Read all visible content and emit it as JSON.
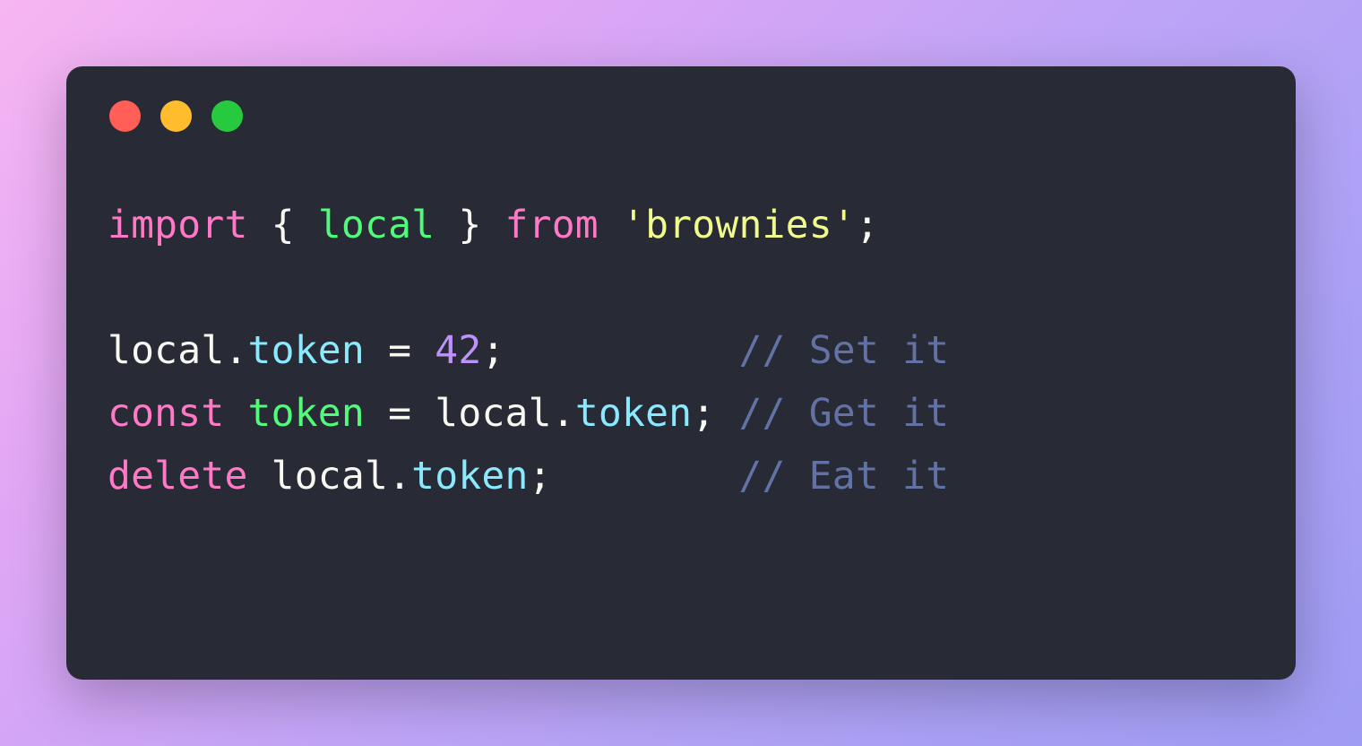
{
  "colors": {
    "window_bg": "#282a36",
    "traffic_red": "#ff5f56",
    "traffic_yellow": "#ffbd2e",
    "traffic_green": "#27c93f",
    "keyword": "#ff79c6",
    "identifier": "#50fa7b",
    "property": "#8be9fd",
    "string": "#f1fa8c",
    "number": "#bd93f9",
    "comment": "#6272a4",
    "plain": "#f8f8f2"
  },
  "code": {
    "lines": [
      [
        {
          "cls": "tok-keyword",
          "text": "import"
        },
        {
          "cls": "tok-plain",
          "text": " "
        },
        {
          "cls": "tok-punct",
          "text": "{"
        },
        {
          "cls": "tok-plain",
          "text": " "
        },
        {
          "cls": "tok-ident",
          "text": "local"
        },
        {
          "cls": "tok-plain",
          "text": " "
        },
        {
          "cls": "tok-punct",
          "text": "}"
        },
        {
          "cls": "tok-plain",
          "text": " "
        },
        {
          "cls": "tok-keyword",
          "text": "from"
        },
        {
          "cls": "tok-plain",
          "text": " "
        },
        {
          "cls": "tok-string",
          "text": "'brownies'"
        },
        {
          "cls": "tok-punct",
          "text": ";"
        }
      ],
      [
        {
          "cls": "tok-plain",
          "text": ""
        }
      ],
      [
        {
          "cls": "tok-plain",
          "text": "local"
        },
        {
          "cls": "tok-punct",
          "text": "."
        },
        {
          "cls": "tok-prop",
          "text": "token"
        },
        {
          "cls": "tok-plain",
          "text": " "
        },
        {
          "cls": "tok-punct",
          "text": "="
        },
        {
          "cls": "tok-plain",
          "text": " "
        },
        {
          "cls": "tok-number",
          "text": "42"
        },
        {
          "cls": "tok-punct",
          "text": ";"
        },
        {
          "cls": "tok-plain",
          "text": "          "
        },
        {
          "cls": "tok-comment",
          "text": "// Set it"
        }
      ],
      [
        {
          "cls": "tok-keyword",
          "text": "const"
        },
        {
          "cls": "tok-plain",
          "text": " "
        },
        {
          "cls": "tok-ident",
          "text": "token"
        },
        {
          "cls": "tok-plain",
          "text": " "
        },
        {
          "cls": "tok-punct",
          "text": "="
        },
        {
          "cls": "tok-plain",
          "text": " local"
        },
        {
          "cls": "tok-punct",
          "text": "."
        },
        {
          "cls": "tok-prop",
          "text": "token"
        },
        {
          "cls": "tok-punct",
          "text": ";"
        },
        {
          "cls": "tok-plain",
          "text": " "
        },
        {
          "cls": "tok-comment",
          "text": "// Get it"
        }
      ],
      [
        {
          "cls": "tok-keyword",
          "text": "delete"
        },
        {
          "cls": "tok-plain",
          "text": " local"
        },
        {
          "cls": "tok-punct",
          "text": "."
        },
        {
          "cls": "tok-prop",
          "text": "token"
        },
        {
          "cls": "tok-punct",
          "text": ";"
        },
        {
          "cls": "tok-plain",
          "text": "        "
        },
        {
          "cls": "tok-comment",
          "text": "// Eat it"
        }
      ]
    ]
  }
}
